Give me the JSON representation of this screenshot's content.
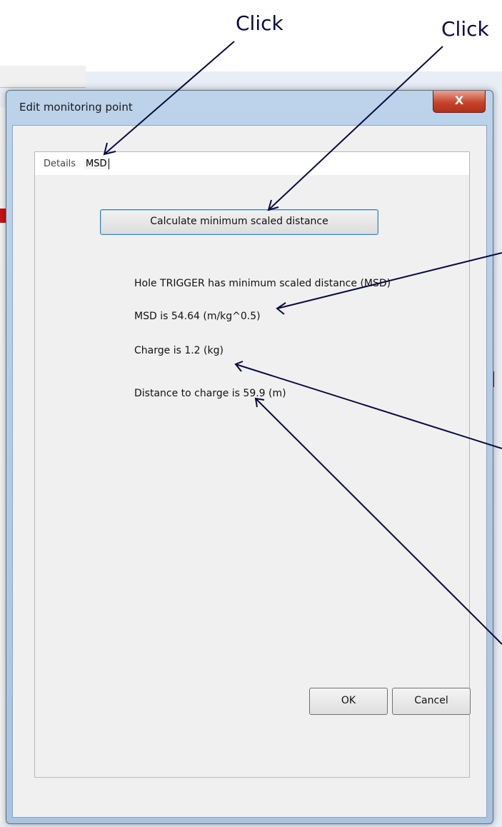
{
  "annotations": {
    "click_left": "Click",
    "click_right": "Click"
  },
  "dialog": {
    "title": "Edit monitoring point",
    "close_label": "X",
    "tabs": [
      {
        "label": "Details"
      },
      {
        "label": "MSD"
      }
    ],
    "calculate_button": "Calculate minimum scaled distance",
    "results": {
      "hole_line": "Hole TRIGGER has minimum scaled distance (MSD)",
      "msd_line": "MSD is 54.64 (m/kg^0.5)",
      "charge_line": "Charge is 1.2 (kg)",
      "distance_line": "Distance to charge is 59.9 (m)"
    },
    "ok_button": "OK",
    "cancel_button": "Cancel"
  }
}
